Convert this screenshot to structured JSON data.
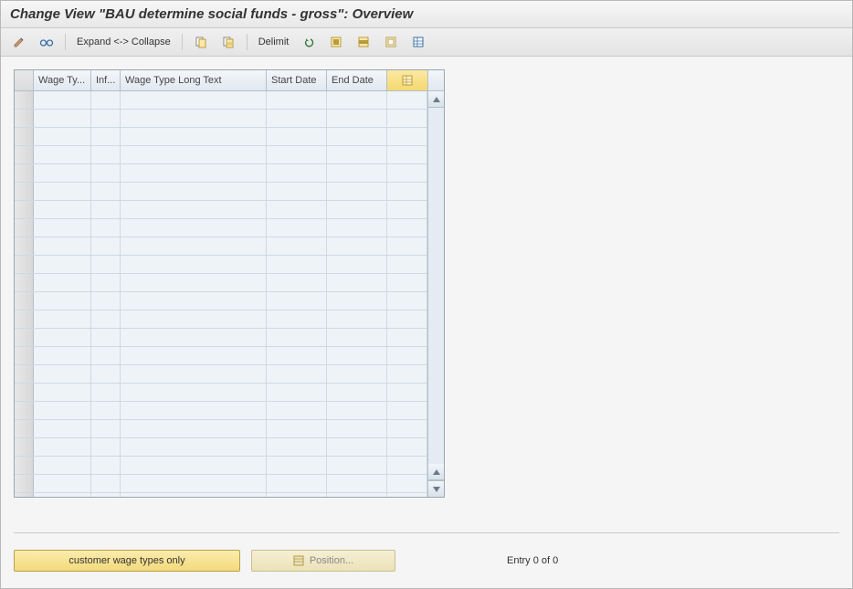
{
  "window": {
    "title": "Change View \"BAU determine social funds - gross\": Overview"
  },
  "toolbar": {
    "expand_collapse_label": "Expand <-> Collapse",
    "delimit_label": "Delimit",
    "icons": {
      "change": "change-display-icon",
      "glasses": "glasses-icon",
      "copy": "copy-icon",
      "copy_as": "copy-as-icon",
      "undo": "undo-icon",
      "select_all": "select-all-icon",
      "select_block": "select-block-icon",
      "deselect": "deselect-all-icon",
      "config": "table-settings-icon"
    }
  },
  "grid": {
    "columns": [
      {
        "label": "Wage Ty..."
      },
      {
        "label": "Inf..."
      },
      {
        "label": "Wage Type Long Text"
      },
      {
        "label": "Start Date"
      },
      {
        "label": "End Date"
      }
    ],
    "row_count": 23
  },
  "footer": {
    "customer_btn": "customer wage types only",
    "position_btn": "Position...",
    "entry_text": "Entry 0 of 0"
  }
}
